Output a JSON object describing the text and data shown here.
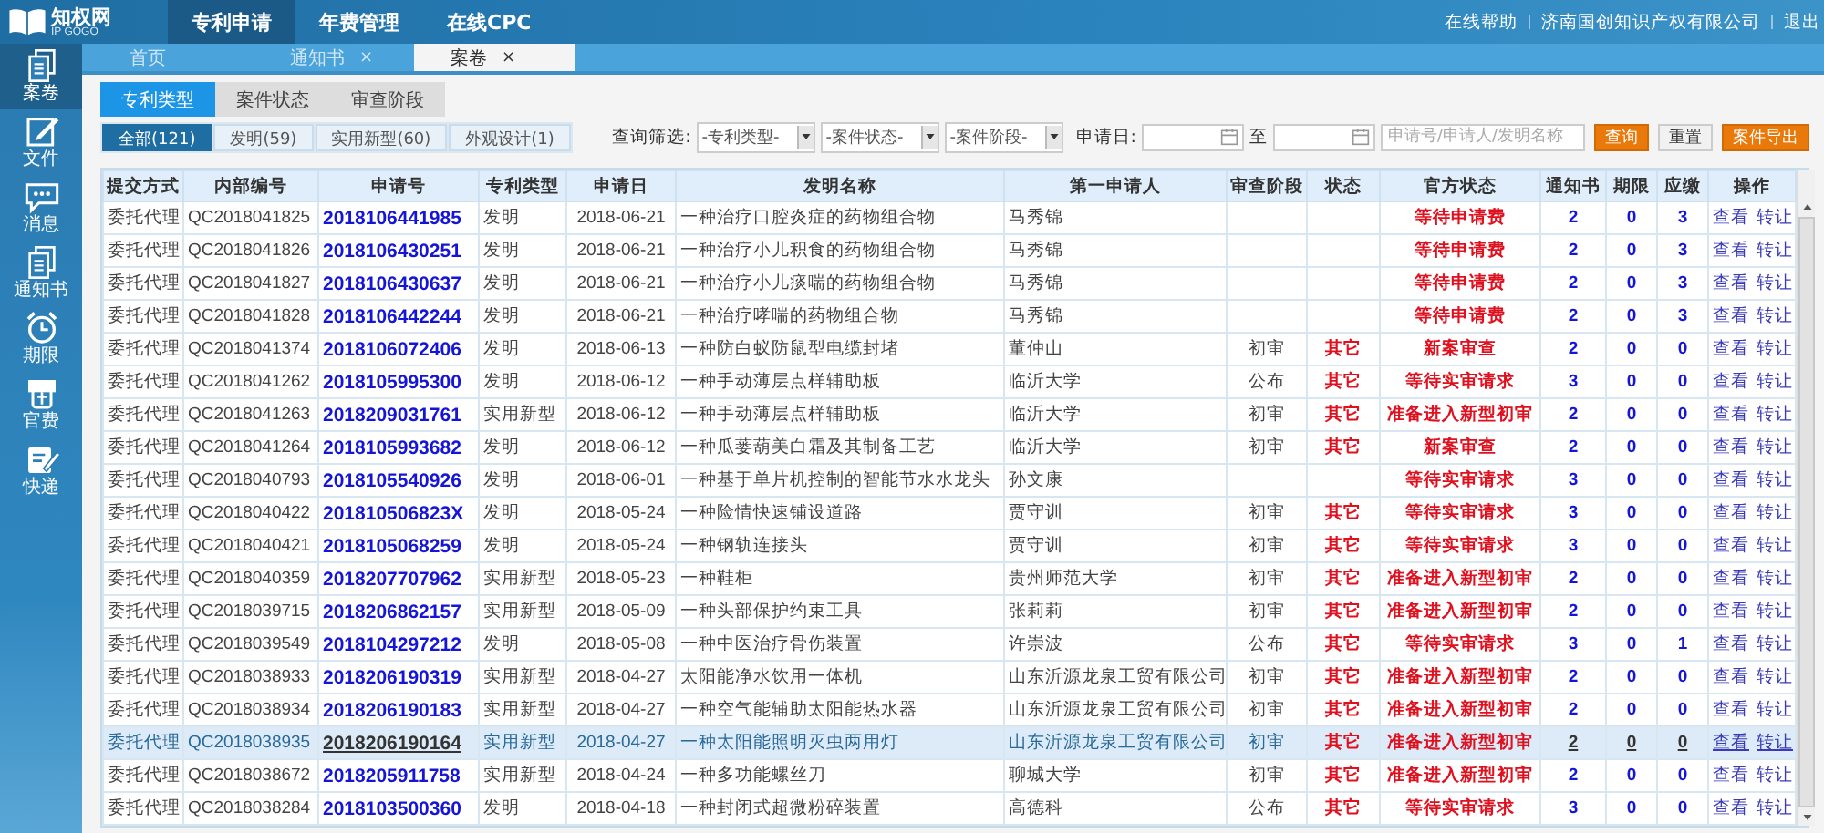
{
  "header": {
    "logo": {
      "name": "知权网",
      "tagline": "IP GOGO"
    },
    "nav": [
      {
        "label": "专利申请",
        "selected": true
      },
      {
        "label": "年费管理",
        "selected": false
      },
      {
        "label": "在线CPC",
        "selected": false
      }
    ],
    "links": [
      "在线帮助",
      "济南国创知识产权有限公司",
      "退出"
    ]
  },
  "sidebar": {
    "items": [
      {
        "label": "案卷",
        "kind": "folder",
        "selected": true
      },
      {
        "label": "文件",
        "kind": "edit",
        "selected": false
      },
      {
        "label": "消息",
        "kind": "chat",
        "selected": false
      },
      {
        "label": "通知书",
        "kind": "docs",
        "selected": false
      },
      {
        "label": "期限",
        "kind": "clock",
        "selected": false
      },
      {
        "label": "官费",
        "kind": "fee",
        "selected": false
      },
      {
        "label": "快递",
        "kind": "note",
        "selected": false
      }
    ]
  },
  "tabs": [
    {
      "label": "首页",
      "selected": false
    },
    {
      "label": "通知书",
      "close": "×",
      "selected": false
    },
    {
      "label": "案卷",
      "close": "×",
      "selected": true
    }
  ],
  "subtabs": [
    {
      "label": "专利类型",
      "selected": true
    },
    {
      "label": "案件状态",
      "selected": false
    },
    {
      "label": "审查阶段",
      "selected": false
    }
  ],
  "chips": [
    {
      "label": "全部(121)",
      "selected": true
    },
    {
      "label": "发明(59)",
      "selected": false
    },
    {
      "label": "实用新型(60)",
      "selected": false
    },
    {
      "label": "外观设计(1)",
      "selected": false
    }
  ],
  "filter": {
    "label": "查询筛选:",
    "selects": [
      "-专利类型-",
      "-案件状态-",
      "-案件阶段-"
    ],
    "date_label": "申请日:",
    "date_sep": "至",
    "search_placeholder": "申请号/申请人/发明名称",
    "buttons": [
      {
        "label": "查询",
        "kind": "primary"
      },
      {
        "label": "重置",
        "kind": "plain"
      },
      {
        "label": "案件导出",
        "kind": "primary"
      }
    ]
  },
  "table": {
    "columns": [
      "提交方式",
      "内部编号",
      "申请号",
      "专利类型",
      "申请日",
      "发明名称",
      "第一申请人",
      "审查阶段",
      "状态",
      "官方状态",
      "通知书",
      "期限",
      "应缴",
      "操作"
    ],
    "rows": [
      {
        "method": "委托代理",
        "internal_no": "QC2018041825",
        "app_no": "2018106441985",
        "type": "发明",
        "date": "2018-06-21",
        "title": "一种治疗口腔炎症的药物组合物",
        "applicant": "马秀锦",
        "official_status": "等待申请费",
        "notices": "2",
        "deadlines": "0",
        "due": "3",
        "actions": [
          "查看",
          "转让"
        ],
        "selected": false
      },
      {
        "method": "委托代理",
        "internal_no": "QC2018041826",
        "app_no": "2018106430251",
        "type": "发明",
        "date": "2018-06-21",
        "title": "一种治疗小儿积食的药物组合物",
        "applicant": "马秀锦",
        "official_status": "等待申请费",
        "notices": "2",
        "deadlines": "0",
        "due": "3",
        "actions": [
          "查看",
          "转让"
        ],
        "selected": false
      },
      {
        "method": "委托代理",
        "internal_no": "QC2018041827",
        "app_no": "2018106430637",
        "type": "发明",
        "date": "2018-06-21",
        "title": "一种治疗小儿痰喘的药物组合物",
        "applicant": "马秀锦",
        "official_status": "等待申请费",
        "notices": "2",
        "deadlines": "0",
        "due": "3",
        "actions": [
          "查看",
          "转让"
        ],
        "selected": false
      },
      {
        "method": "委托代理",
        "internal_no": "QC2018041828",
        "app_no": "2018106442244",
        "type": "发明",
        "date": "2018-06-21",
        "title": "一种治疗哮喘的药物组合物",
        "applicant": "马秀锦",
        "official_status": "等待申请费",
        "notices": "2",
        "deadlines": "0",
        "due": "3",
        "actions": [
          "查看",
          "转让"
        ],
        "selected": false
      },
      {
        "method": "委托代理",
        "internal_no": "QC2018041374",
        "app_no": "2018106072406",
        "type": "发明",
        "date": "2018-06-13",
        "title": "一种防白蚁防鼠型电缆封堵",
        "applicant": "董仲山",
        "stage": "初审",
        "status": "其它",
        "official_status": "新案审查",
        "notices": "2",
        "deadlines": "0",
        "due": "0",
        "actions": [
          "查看",
          "转让"
        ],
        "selected": false
      },
      {
        "method": "委托代理",
        "internal_no": "QC2018041262",
        "app_no": "2018105995300",
        "type": "发明",
        "date": "2018-06-12",
        "title": "一种手动薄层点样辅助板",
        "applicant": "临沂大学",
        "stage": "公布",
        "status": "其它",
        "official_status": "等待实审请求",
        "notices": "3",
        "deadlines": "0",
        "due": "0",
        "actions": [
          "查看",
          "转让"
        ],
        "selected": false
      },
      {
        "method": "委托代理",
        "internal_no": "QC2018041263",
        "app_no": "2018209031761",
        "type": "实用新型",
        "date": "2018-06-12",
        "title": "一种手动薄层点样辅助板",
        "applicant": "临沂大学",
        "stage": "初审",
        "status": "其它",
        "official_status": "准备进入新型初审",
        "notices": "2",
        "deadlines": "0",
        "due": "0",
        "actions": [
          "查看",
          "转让"
        ],
        "selected": false
      },
      {
        "method": "委托代理",
        "internal_no": "QC2018041264",
        "app_no": "2018105993682",
        "type": "发明",
        "date": "2018-06-12",
        "title": "一种瓜蒌葫美白霜及其制备工艺",
        "applicant": "临沂大学",
        "stage": "初审",
        "status": "其它",
        "official_status": "新案审查",
        "notices": "2",
        "deadlines": "0",
        "due": "0",
        "actions": [
          "查看",
          "转让"
        ],
        "selected": false
      },
      {
        "method": "委托代理",
        "internal_no": "QC2018040793",
        "app_no": "2018105540926",
        "type": "发明",
        "date": "2018-06-01",
        "title": "一种基于单片机控制的智能节水水龙头",
        "applicant": "孙文康",
        "official_status": "等待实审请求",
        "notices": "3",
        "deadlines": "0",
        "due": "0",
        "actions": [
          "查看",
          "转让"
        ],
        "selected": false
      },
      {
        "method": "委托代理",
        "internal_no": "QC2018040422",
        "app_no": "201810506823X",
        "type": "发明",
        "date": "2018-05-24",
        "title": "一种险情快速铺设道路",
        "applicant": "贾守训",
        "stage": "初审",
        "status": "其它",
        "official_status": "等待实审请求",
        "notices": "3",
        "deadlines": "0",
        "due": "0",
        "actions": [
          "查看",
          "转让"
        ],
        "selected": false
      },
      {
        "method": "委托代理",
        "internal_no": "QC2018040421",
        "app_no": "2018105068259",
        "type": "发明",
        "date": "2018-05-24",
        "title": "一种钢轨连接头",
        "applicant": "贾守训",
        "stage": "初审",
        "status": "其它",
        "official_status": "等待实审请求",
        "notices": "3",
        "deadlines": "0",
        "due": "0",
        "actions": [
          "查看",
          "转让"
        ],
        "selected": false
      },
      {
        "method": "委托代理",
        "internal_no": "QC2018040359",
        "app_no": "2018207707962",
        "type": "实用新型",
        "date": "2018-05-23",
        "title": "一种鞋柜",
        "applicant": "贵州师范大学",
        "stage": "初审",
        "status": "其它",
        "official_status": "准备进入新型初审",
        "notices": "2",
        "deadlines": "0",
        "due": "0",
        "actions": [
          "查看",
          "转让"
        ],
        "selected": false
      },
      {
        "method": "委托代理",
        "internal_no": "QC2018039715",
        "app_no": "2018206862157",
        "type": "实用新型",
        "date": "2018-05-09",
        "title": "一种头部保护约束工具",
        "applicant": "张莉莉",
        "stage": "初审",
        "status": "其它",
        "official_status": "准备进入新型初审",
        "notices": "2",
        "deadlines": "0",
        "due": "0",
        "actions": [
          "查看",
          "转让"
        ],
        "selected": false
      },
      {
        "method": "委托代理",
        "internal_no": "QC2018039549",
        "app_no": "2018104297212",
        "type": "发明",
        "date": "2018-05-08",
        "title": "一种中医治疗骨伤装置",
        "applicant": "许崇波",
        "stage": "公布",
        "status": "其它",
        "official_status": "等待实审请求",
        "notices": "3",
        "deadlines": "0",
        "due": "1",
        "actions": [
          "查看",
          "转让"
        ],
        "selected": false
      },
      {
        "method": "委托代理",
        "internal_no": "QC2018038933",
        "app_no": "2018206190319",
        "type": "实用新型",
        "date": "2018-04-27",
        "title": "太阳能净水饮用一体机",
        "applicant": "山东沂源龙泉工贸有限公司",
        "stage": "初审",
        "status": "其它",
        "official_status": "准备进入新型初审",
        "notices": "2",
        "deadlines": "0",
        "due": "0",
        "actions": [
          "查看",
          "转让"
        ],
        "selected": false
      },
      {
        "method": "委托代理",
        "internal_no": "QC2018038934",
        "app_no": "2018206190183",
        "type": "实用新型",
        "date": "2018-04-27",
        "title": "一种空气能辅助太阳能热水器",
        "applicant": "山东沂源龙泉工贸有限公司",
        "stage": "初审",
        "status": "其它",
        "official_status": "准备进入新型初审",
        "notices": "2",
        "deadlines": "0",
        "due": "0",
        "actions": [
          "查看",
          "转让"
        ],
        "selected": false
      },
      {
        "method": "委托代理",
        "internal_no": "QC2018038935",
        "app_no": "2018206190164",
        "type": "实用新型",
        "date": "2018-04-27",
        "title": "一种太阳能照明灭虫两用灯",
        "applicant": "山东沂源龙泉工贸有限公司",
        "stage": "初审",
        "status": "其它",
        "official_status": "准备进入新型初审",
        "notices": "2",
        "deadlines": "0",
        "due": "0",
        "actions": [
          "查看",
          "转让"
        ],
        "selected": true
      },
      {
        "method": "委托代理",
        "internal_no": "QC2018038672",
        "app_no": "2018205911758",
        "type": "实用新型",
        "date": "2018-04-24",
        "title": "一种多功能螺丝刀",
        "applicant": "聊城大学",
        "stage": "初审",
        "status": "其它",
        "official_status": "准备进入新型初审",
        "notices": "2",
        "deadlines": "0",
        "due": "0",
        "actions": [
          "查看",
          "转让"
        ],
        "selected": false
      },
      {
        "method": "委托代理",
        "internal_no": "QC2018038284",
        "app_no": "2018103500360",
        "type": "发明",
        "date": "2018-04-18",
        "title": "一种封闭式超微粉碎装置",
        "applicant": "高德科",
        "stage": "公布",
        "status": "其它",
        "official_status": "等待实审请求",
        "notices": "3",
        "deadlines": "0",
        "due": "0",
        "actions": [
          "查看",
          "转让"
        ],
        "selected": false
      }
    ]
  }
}
